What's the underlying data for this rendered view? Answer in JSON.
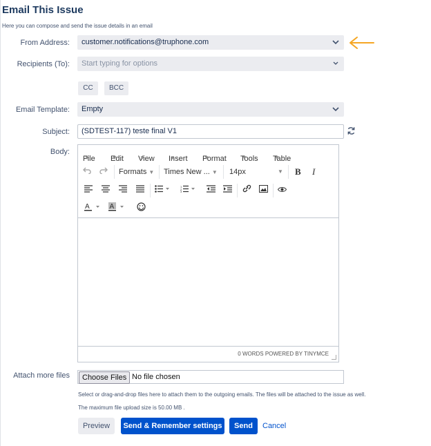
{
  "header": {
    "title": "Email This Issue",
    "subtitle": "Here you can compose and send the issue details in an email"
  },
  "form": {
    "from_label": "From Address:",
    "from_value": "customer.notifications@truphone.com",
    "recipients_label": "Recipients (To):",
    "recipients_placeholder": "Start typing for options",
    "cc_label": "CC",
    "bcc_label": "BCC",
    "template_label": "Email Template:",
    "template_value": "Empty",
    "subject_label": "Subject:",
    "subject_value": "(SDTEST-117) teste final V1",
    "body_label": "Body:"
  },
  "editor": {
    "menus": [
      "File",
      "Edit",
      "View",
      "Insert",
      "Format",
      "Tools",
      "Table"
    ],
    "formats_label": "Formats",
    "font_value": "Times New ...",
    "size_value": "14px",
    "status": "0 WORDS POWERED BY TINYMCE"
  },
  "attach": {
    "label": "Attach more files",
    "choose_label": "Choose Files",
    "no_file_text": "No file chosen",
    "help1": "Select or drag-and-drop files here to attach them to the outgoing emails. The files will be attached to the issue as well.",
    "help2": "The maximum file upload size is 50.00 MB ."
  },
  "actions": {
    "preview": "Preview",
    "send_remember": "Send & Remember settings",
    "send": "Send",
    "cancel": "Cancel"
  },
  "colors": {
    "accent_arrow": "#f5a623",
    "primary_button": "#0052cc"
  }
}
